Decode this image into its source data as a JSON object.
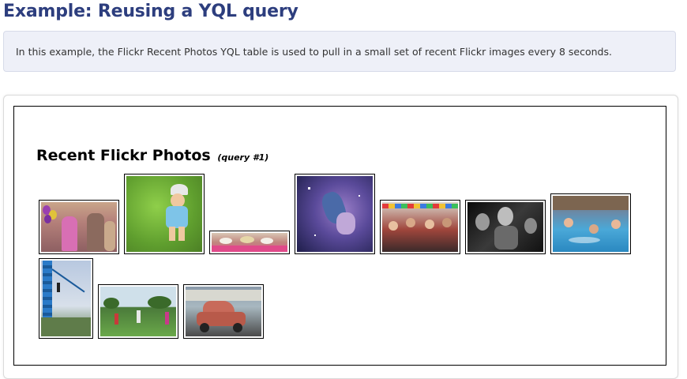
{
  "header": {
    "title": "Example: Reusing a YQL query"
  },
  "intro": {
    "text": "In this example, the Flickr Recent Photos YQL table is used to pull in a small set of recent Flickr images every 8 seconds."
  },
  "widget": {
    "heading": "Recent Flickr Photos",
    "query_label": "(query #1)"
  },
  "photos": [
    {
      "subject": "party-balloons-people"
    },
    {
      "subject": "toddler-on-grass"
    },
    {
      "subject": "food-table"
    },
    {
      "subject": "space-nebula-art"
    },
    {
      "subject": "crowd-at-event"
    },
    {
      "subject": "black-and-white-people"
    },
    {
      "subject": "swimming-pool"
    },
    {
      "subject": "tower-and-sky"
    },
    {
      "subject": "kids-on-field"
    },
    {
      "subject": "vintage-car"
    }
  ],
  "colors": {
    "title": "#2d3e7e",
    "intro_background": "#eef0f8"
  }
}
